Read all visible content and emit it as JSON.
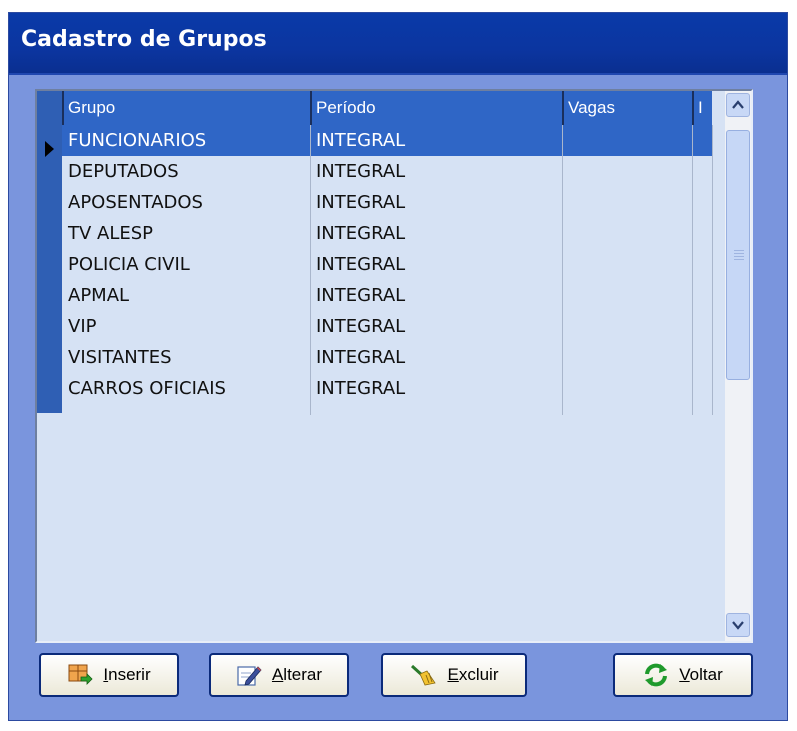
{
  "window": {
    "title": "Cadastro de Grupos"
  },
  "grid": {
    "columns": [
      "Grupo",
      "Período",
      "Vagas",
      "I"
    ],
    "rows": [
      {
        "grupo": "FUNCIONARIOS",
        "periodo": "INTEGRAL",
        "vagas": "",
        "i": ""
      },
      {
        "grupo": "DEPUTADOS",
        "periodo": "INTEGRAL",
        "vagas": "",
        "i": ""
      },
      {
        "grupo": "APOSENTADOS",
        "periodo": "INTEGRAL",
        "vagas": "",
        "i": ""
      },
      {
        "grupo": "TV ALESP",
        "periodo": "INTEGRAL",
        "vagas": "",
        "i": ""
      },
      {
        "grupo": "POLICIA CIVIL",
        "periodo": "INTEGRAL",
        "vagas": "",
        "i": ""
      },
      {
        "grupo": "APMAL",
        "periodo": "INTEGRAL",
        "vagas": "",
        "i": ""
      },
      {
        "grupo": "VIP",
        "periodo": "INTEGRAL",
        "vagas": "",
        "i": ""
      },
      {
        "grupo": "VISITANTES",
        "periodo": "INTEGRAL",
        "vagas": "",
        "i": ""
      },
      {
        "grupo": "CARROS OFICIAIS",
        "periodo": "INTEGRAL",
        "vagas": "",
        "i": ""
      }
    ],
    "selected_row": 0
  },
  "buttons": {
    "inserir": {
      "hotkey": "I",
      "rest": "nserir",
      "icon": "add-record-icon"
    },
    "alterar": {
      "hotkey": "A",
      "rest": "lterar",
      "icon": "edit-pencil-icon"
    },
    "excluir": {
      "hotkey": "E",
      "rest": "xcluir",
      "icon": "broom-icon"
    },
    "voltar": {
      "hotkey": "V",
      "rest": "oltar",
      "icon": "refresh-arrows-icon"
    }
  },
  "colors": {
    "title_bar": "#0b35a0",
    "window_bg": "#7a95dd",
    "grid_bg": "#d6e2f4",
    "selection": "#2f66c6"
  }
}
